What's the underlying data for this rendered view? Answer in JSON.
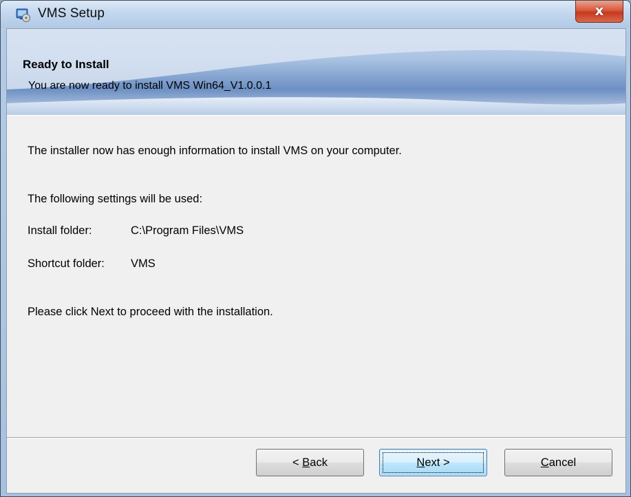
{
  "window": {
    "title": "VMS Setup",
    "close_label": "x"
  },
  "banner": {
    "title": "Ready to Install",
    "subtitle": "You are now ready to install VMS Win64_V1.0.0.1"
  },
  "body": {
    "intro": "The installer now has enough information to install VMS on your computer.",
    "settings_heading": "The following settings will be used:",
    "install_folder_label": "Install folder:",
    "install_folder_value": "C:\\Program Files\\VMS",
    "shortcut_folder_label": "Shortcut folder:",
    "shortcut_folder_value": "VMS",
    "proceed_text": "Please click Next to proceed with the installation."
  },
  "buttons": {
    "back": {
      "prefix": "< ",
      "accel": "B",
      "rest": "ack"
    },
    "next": {
      "accel": "N",
      "rest": "ext >"
    },
    "cancel": {
      "accel": "C",
      "rest": "ancel"
    }
  },
  "colors": {
    "banner_gradient_dark": "#6d8fc3",
    "window_close": "#c63a1f",
    "default_button_border": "#3c7fb1"
  },
  "icons": {
    "title_icon": "installer-icon",
    "close_icon": "close-icon"
  }
}
